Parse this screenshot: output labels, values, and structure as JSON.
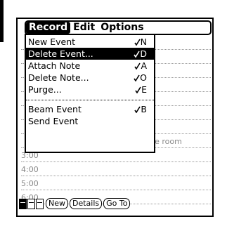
{
  "menubar": {
    "menus": [
      {
        "label": "Record",
        "active": true
      },
      {
        "label": "Edit",
        "active": false
      },
      {
        "label": "Options",
        "active": false
      }
    ]
  },
  "record_menu": {
    "items": [
      {
        "label": "New Event",
        "shortcut": "N",
        "selected": false
      },
      {
        "label": "Delete Event...",
        "shortcut": "D",
        "selected": true
      },
      {
        "label": "Attach Note",
        "shortcut": "A",
        "selected": false
      },
      {
        "label": "Delete Note...",
        "shortcut": "O",
        "selected": false
      },
      {
        "label": "Purge...",
        "shortcut": "E",
        "selected": false
      },
      {
        "label": "Beam Event",
        "shortcut": "B",
        "selected": false
      },
      {
        "label": "Send Event",
        "shortcut": "",
        "selected": false
      }
    ]
  },
  "schedule": {
    "visible_event_text": "rence room",
    "times": [
      "3:00",
      "4:00",
      "5:00",
      "6:00"
    ]
  },
  "toolbar": {
    "new_label": "New",
    "details_label": "Details",
    "goto_label": "Go To"
  }
}
